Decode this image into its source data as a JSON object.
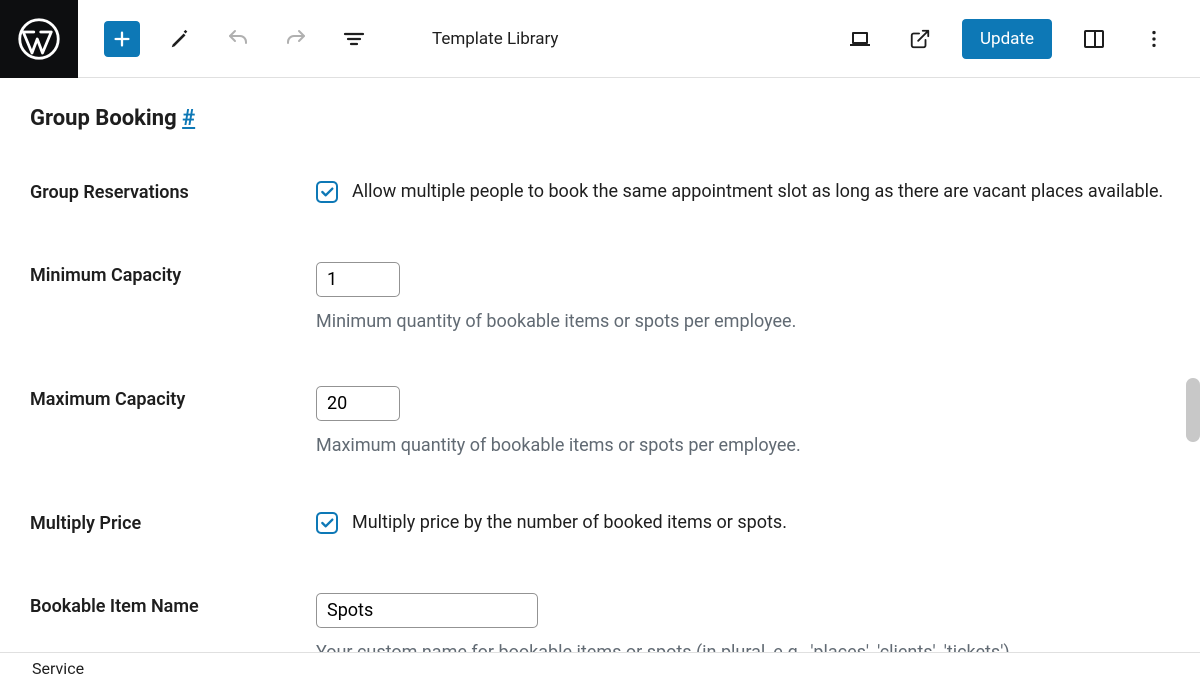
{
  "toolbar": {
    "title": "Template Library",
    "update_label": "Update"
  },
  "page": {
    "title": "Group Booking ",
    "anchor": "#"
  },
  "fields": {
    "group_reservations": {
      "label": "Group Reservations",
      "checked": true,
      "text": "Allow multiple people to book the same appointment slot as long as there are vacant places available."
    },
    "min_capacity": {
      "label": "Minimum Capacity",
      "value": "1",
      "help": "Minimum quantity of bookable items or spots per employee."
    },
    "max_capacity": {
      "label": "Maximum Capacity",
      "value": "20",
      "help": "Maximum quantity of bookable items or spots per employee."
    },
    "multiply_price": {
      "label": "Multiply Price",
      "checked": true,
      "text": "Multiply price by the number of booked items or spots."
    },
    "bookable_item_name": {
      "label": "Bookable Item Name",
      "value": "Spots",
      "help": "Your custom name for bookable items or spots (in plural, e.g., 'places', 'clients', 'tickets')."
    }
  },
  "footer": {
    "breadcrumb": "Service"
  }
}
